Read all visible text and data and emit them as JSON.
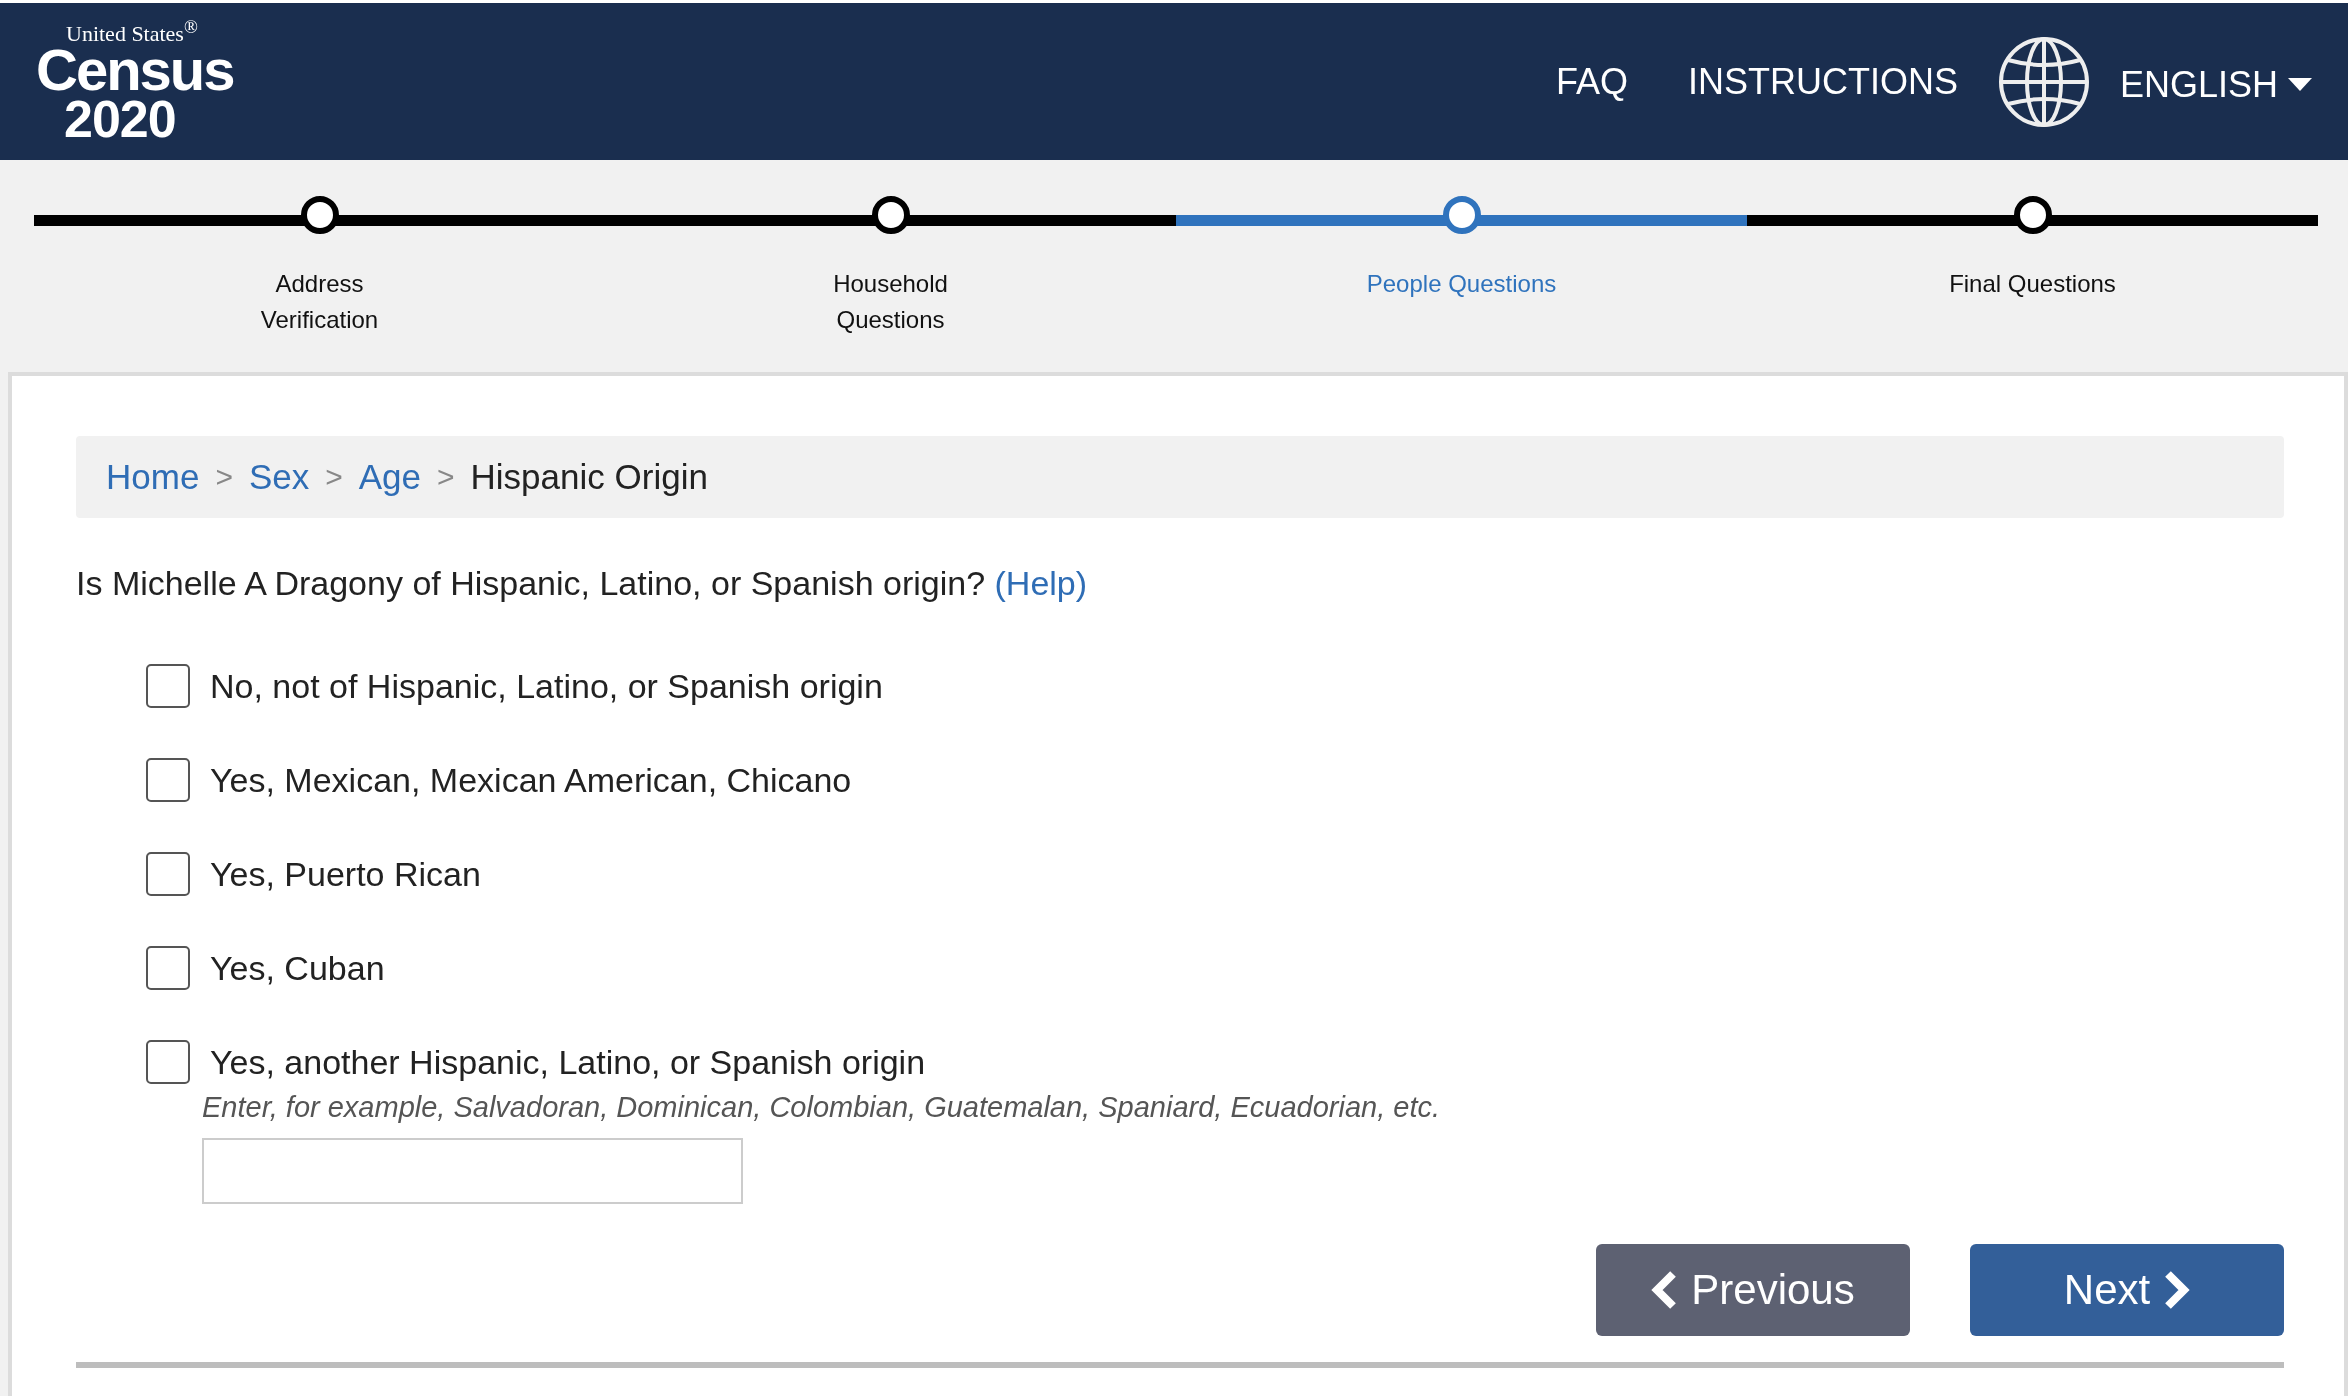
{
  "header": {
    "logo": {
      "subtitle": "United States$^{®}$",
      "title": "Census",
      "year": "2020"
    },
    "links": [
      "FAQ",
      "INSTRUCTIONS"
    ],
    "language": "ENGLISH"
  },
  "progress": [
    {
      "label": "Address Verification",
      "selected": false
    },
    {
      "label": "Household Questions",
      "selected": false
    },
    {
      "label": "People Questions",
      "selected": true
    },
    {
      "label": "Final Questions",
      "selected": false
    }
  ],
  "breadcrumb": [
    {
      "label": "Home",
      "link": true
    },
    {
      "separator": ">",
      "label": "Sex",
      "link": true
    },
    {
      "separator": ">",
      "label": "Age",
      "link": true
    },
    {
      "separator": ">",
      "label": "Hispanic Origin",
      "link": false
    }
  ],
  "question": {
    "text": "Is Michelle A Dragony of Hispanic, Latino, or Spanish origin?",
    "help": "(Help)"
  },
  "options": [
    {
      "label": "No, not of Hispanic, Latino, or Spanish origin",
      "checked": false
    },
    {
      "label": "Yes, Mexican, Mexican American, Chicano",
      "checked": false
    },
    {
      "label": "Yes, Puerto Rican",
      "checked": false
    },
    {
      "label": "Yes, Cuban",
      "checked": false
    },
    {
      "label": "Yes, another Hispanic, Latino, or Spanish origin",
      "checked": false,
      "hint": "Enter, for example, Salvadoran, Dominican, Colombian, Guatemalan, Spaniard, Ecuadorian, etc.",
      "has_input": true
    }
  ],
  "buttons": {
    "previous": "Previous",
    "next": "Next"
  }
}
